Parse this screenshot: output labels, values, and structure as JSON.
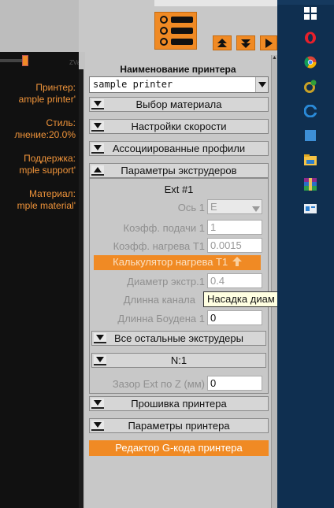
{
  "viewer": {
    "zval_label": "ZVal",
    "info": [
      {
        "label": "Принтер:",
        "value": "ample printer'"
      },
      {
        "label": "Стиль:",
        "value": "лнение:20.0%"
      },
      {
        "label": "Поддержка:",
        "value": "mple support'"
      },
      {
        "label": "Материал:",
        "value": "mple material'"
      }
    ]
  },
  "panel": {
    "title": "Наименование принтера",
    "printer_select_value": "sample printer",
    "sections_top": [
      {
        "label": "Выбор материала",
        "expanded": false
      },
      {
        "label": "Настройки скорости",
        "expanded": false
      },
      {
        "label": "Ассоциированные профили",
        "expanded": false
      },
      {
        "label": "Параметры экструдеров",
        "expanded": true
      }
    ],
    "extruder": {
      "header": "Ext #1",
      "axis_label": "Ось 1",
      "axis_value": "E",
      "feed_coef_label": "Коэфф. подачи 1",
      "feed_coef_value": "1",
      "heat_coef_label": "Коэфф. нагрева Т1",
      "heat_coef_value": "0.0015",
      "heat_calc_button": "Калькулятор нагрева Т1",
      "diameter_label": "Диаметр экстр.1",
      "diameter_value": "0.4",
      "channel_label": "Длинна канала",
      "bowden_label": "Длинна Боудена 1",
      "bowden_value": "0",
      "all_extruders_label": "Все остальные экструдеры",
      "n_label": "N:1",
      "z_gap_label": "Зазор Ext по Z (мм)",
      "z_gap_value": "0"
    },
    "sections_bottom": [
      {
        "label": "Прошивка принтера",
        "expanded": false
      },
      {
        "label": "Параметры принтера",
        "expanded": false
      }
    ],
    "gcode_button": "Редактор G-кода принтера",
    "tooltip": "Насадка диам"
  },
  "colors": {
    "accent": "#f08a24",
    "info_text": "#f0943a",
    "panel_bg": "#c8c8c8",
    "taskbar_bg": "#0f2f50"
  },
  "taskbar": {
    "icons": [
      "windows-icon",
      "opera-icon",
      "chrome-icon",
      "app-badge-icon",
      "edge-icon",
      "blue-square-icon",
      "file-explorer-icon",
      "winrar-icon",
      "window-app-icon"
    ]
  }
}
